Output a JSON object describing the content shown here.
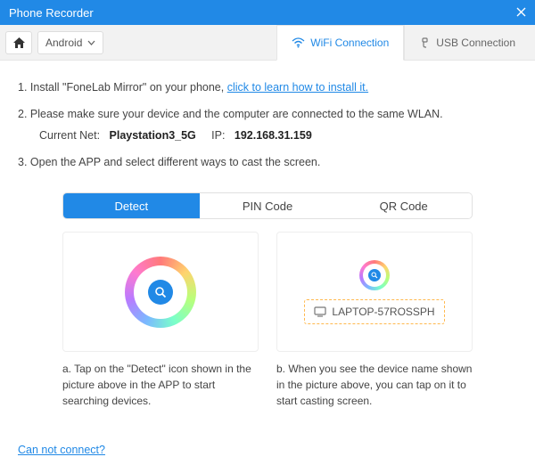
{
  "window": {
    "title": "Phone Recorder"
  },
  "toolbar": {
    "platform_label": "Android",
    "tabs": {
      "wifi": "WiFi Connection",
      "usb": "USB Connection"
    }
  },
  "steps": {
    "s1_prefix": "1. Install \"FoneLab Mirror\" on your phone, ",
    "s1_link": "click to learn how to install it.",
    "s2": "2. Please make sure your device and the computer are connected to the same WLAN.",
    "s3": "3. Open the APP and select different ways to cast the screen."
  },
  "network": {
    "current_net_label": "Current Net:",
    "ssid": "Playstation3_5G",
    "ip_label": "IP:",
    "ip": "192.168.31.159"
  },
  "methods": {
    "detect": "Detect",
    "pin": "PIN Code",
    "qr": "QR Code"
  },
  "detect_panel": {
    "device_name": "LAPTOP-57ROSSPH",
    "caption_a": "a. Tap on the \"Detect\" icon shown in the picture above in the APP to start searching devices.",
    "caption_b": "b. When you see the device name shown in the picture above, you can tap on it to start casting screen."
  },
  "footer": {
    "cannot_connect": "Can not connect?"
  }
}
